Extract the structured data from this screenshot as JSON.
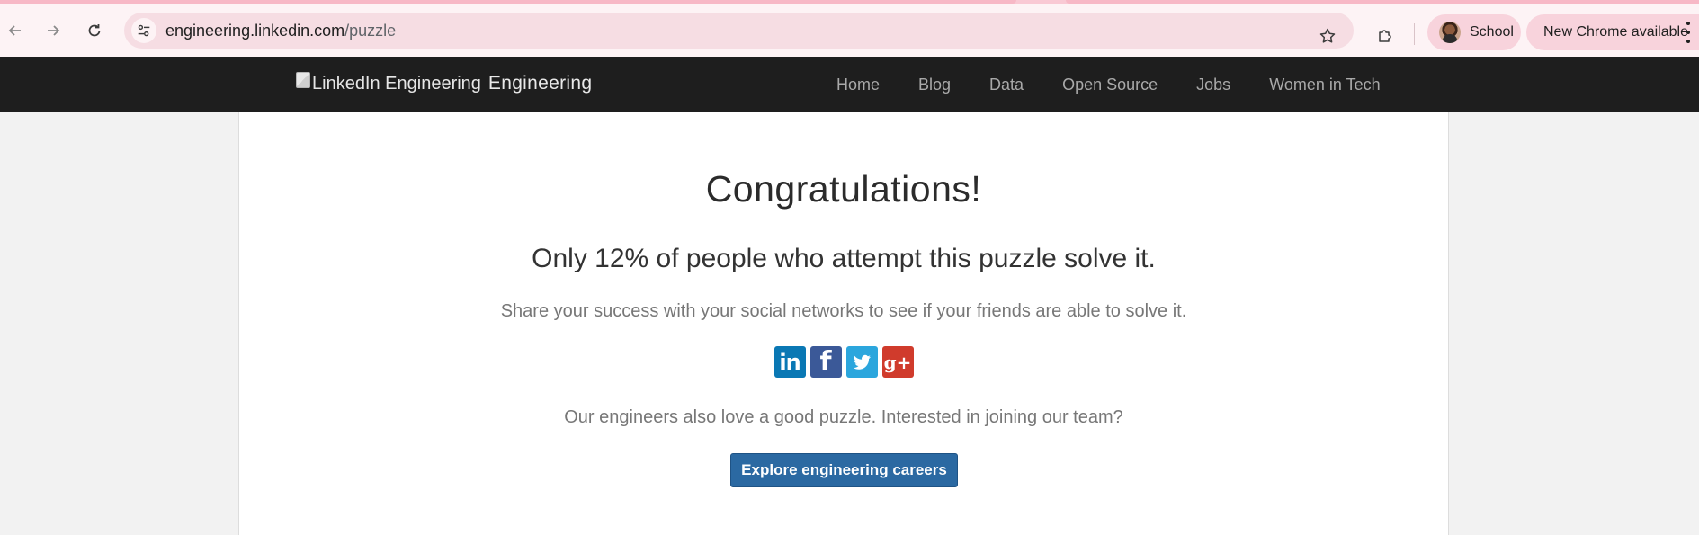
{
  "browser": {
    "url_host": "engineering.linkedin.com",
    "url_path": "/puzzle",
    "profile_label": "School",
    "update_label": "New Chrome available"
  },
  "header": {
    "logo_alt": "LinkedIn Engineering",
    "brand": "Engineering",
    "nav": [
      "Home",
      "Blog",
      "Data",
      "Open Source",
      "Jobs",
      "Women in Tech"
    ]
  },
  "main": {
    "headline": "Congratulations!",
    "subhead": "Only 12% of people who attempt this puzzle solve it.",
    "share_text": "Share your success with your social networks to see if your friends are able to solve it.",
    "social_icons": [
      "linkedin-icon",
      "facebook-icon",
      "twitter-icon",
      "google-plus-icon"
    ],
    "team_text": "Our engineers also love a good puzzle. Interested in joining our team?",
    "cta_label": "Explore engineering careers"
  },
  "colors": {
    "header_bg": "#1e1e1e",
    "cta_bg": "#2b69a2",
    "linkedin": "#0a78b4",
    "facebook": "#3b5998",
    "twitter": "#2ba6dd",
    "google_plus": "#d03b2c"
  }
}
